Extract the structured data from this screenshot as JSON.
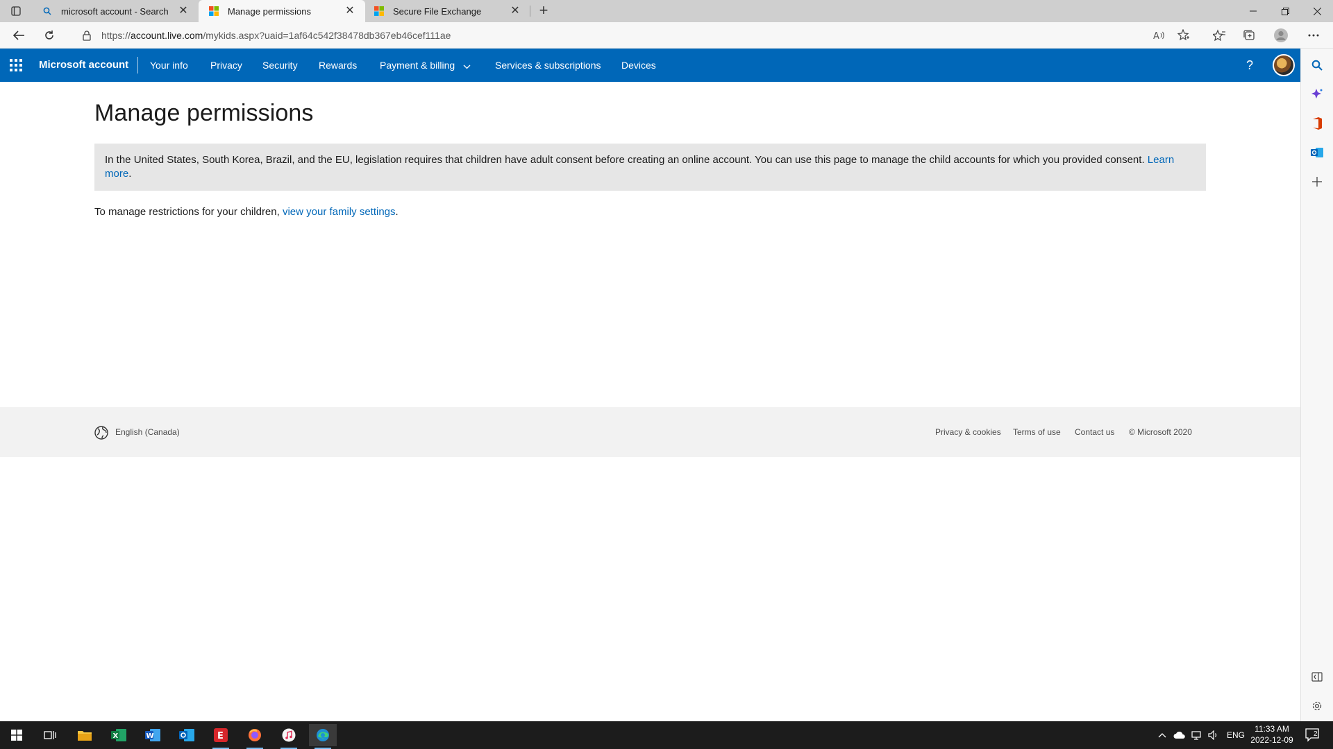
{
  "browser": {
    "tabs": [
      {
        "title": "microsoft account - Search",
        "icon": "search-icon"
      },
      {
        "title": "Manage permissions",
        "icon": "microsoft-logo-icon",
        "active": true
      },
      {
        "title": "Secure File Exchange",
        "icon": "microsoft-logo-icon"
      }
    ],
    "url_prefix": "https://",
    "url_host": "account.live.com",
    "url_path": "/mykids.aspx?uaid=1af64c542f38478db367eb46cef111ae"
  },
  "msnav": {
    "brand": "Microsoft account",
    "links": [
      "Your info",
      "Privacy",
      "Security",
      "Rewards",
      "Payment & billing",
      "Services & subscriptions",
      "Devices"
    ],
    "help": "?"
  },
  "main": {
    "title": "Manage permissions",
    "notice_text": "In the United States, South Korea, Brazil, and the EU, legislation requires that children have adult consent before creating an online account. You can use this page to manage the child accounts for which you provided consent.",
    "notice_link": "Learn more",
    "notice_end": ".",
    "manage_text": "To manage restrictions for your children, ",
    "manage_link": "view your family settings",
    "manage_end": "."
  },
  "footer": {
    "language": "English (Canada)",
    "links": [
      "Privacy & cookies",
      "Terms of use",
      "Contact us",
      "© Microsoft 2020"
    ]
  },
  "taskbar": {
    "lang": "ENG",
    "time": "11:33 AM",
    "date": "2022-12-09",
    "notification_count": "2"
  },
  "colors": {
    "accent": "#0067b8",
    "notice_bg": "#e6e6e6",
    "footer_bg": "#f2f2f2"
  }
}
